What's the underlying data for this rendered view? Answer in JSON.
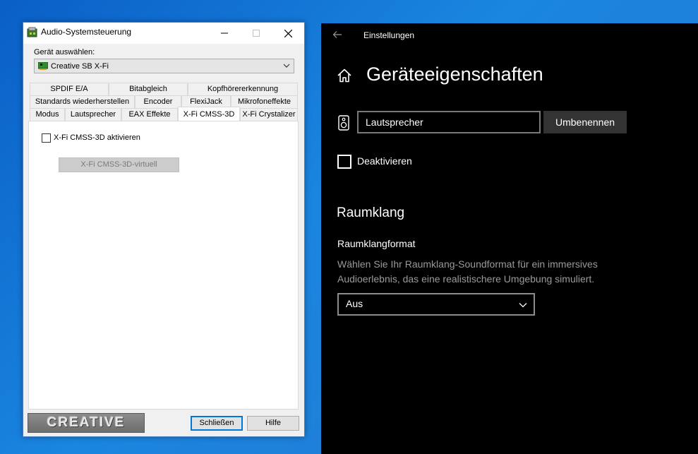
{
  "left_window": {
    "title": "Audio-Systemsteuerung",
    "device_label": "Gerät auswählen:",
    "device_value": "Creative SB X-Fi",
    "tabs_row1": [
      "SPDIF E/A",
      "Bitabgleich",
      "Kopfhörererkennung"
    ],
    "tabs_row2": [
      "Standards wiederherstellen",
      "Encoder",
      "FlexiJack",
      "Mikrofoneffekte"
    ],
    "tabs_row3": [
      "Modus",
      "Lautsprecher",
      "EAX Effekte",
      "X-Fi CMSS-3D",
      "X-Fi Crystalizer"
    ],
    "active_tab": "X-Fi CMSS-3D",
    "cmss_enable_label": "X-Fi CMSS-3D aktivieren",
    "cmss_enable_checked": false,
    "cmss_virtual_button": "X-Fi CMSS-3D-virtuell",
    "logo_text": "CREATIVE",
    "close_button": "Schließen",
    "help_button": "Hilfe"
  },
  "right_window": {
    "app_title": "Einstellungen",
    "page_title": "Geräteeigenschaften",
    "name_value": "Lautsprecher",
    "rename_button": "Umbenennen",
    "disable_label": "Deaktivieren",
    "disable_checked": false,
    "section_title": "Raumklang",
    "format_label": "Raumklangformat",
    "format_description": "Wählen Sie Ihr Raumklang-Soundformat für ein immersives Audioerlebnis, das eine realistischere Umgebung simuliert.",
    "format_value": "Aus"
  },
  "colors": {
    "desktop": "#1a86e0",
    "focus_accent": "#0078d7",
    "settings_bg": "#000000",
    "rename_button_bg": "#333333"
  }
}
